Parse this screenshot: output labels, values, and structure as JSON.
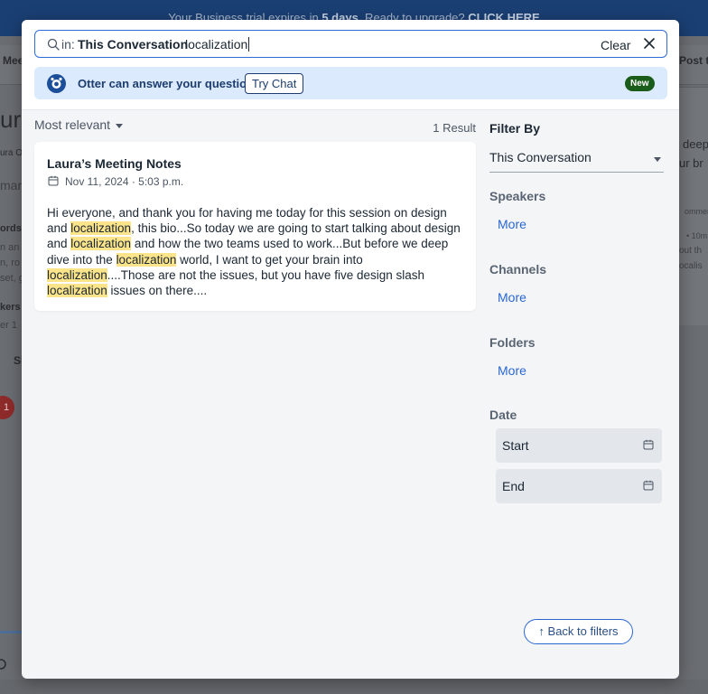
{
  "background": {
    "banner_text": "Your Business trial expires in",
    "banner_days": "5 days",
    "banner_cta_prefix": ". Ready to upgrade?",
    "banner_cta": "CLICK HERE",
    "nav_left": "Mee",
    "nav_right": "Post t",
    "right_tab": "line",
    "title_fragment": "ur",
    "author_fragment": "ura O",
    "summary_fragment": "mar",
    "keywords_label": "ords",
    "kw_lines": [
      "n an",
      "n, ro",
      "set, g"
    ],
    "speakers_label": "kers",
    "speaker_fragment": "er 1",
    "share_fragment": "Sh",
    "badge": "1",
    "rp_line1": "deep",
    "rp_line2": "ur br",
    "rp_comment": "ommen",
    "rp_time": "•  10m",
    "rp_out1": "out th",
    "rp_out2": "ocalis"
  },
  "search": {
    "scope_prefix": "in:",
    "scope": "This Conversation",
    "query": "localization",
    "clear_label": "Clear"
  },
  "otter_prompt": {
    "message": "Otter can answer your question",
    "button": "Try Chat",
    "badge": "New"
  },
  "results": {
    "sort_label": "Most relevant",
    "count_label": "1 Result",
    "items": [
      {
        "title": "Laura’s Meeting Notes",
        "date": "Nov 11, 2024 · 5:03 p.m.",
        "snippet_parts": [
          "Hi everyone, and thank you for having me today for this session on design and ",
          "localization",
          ", this bio...So today we are going to start talking about design and ",
          "localization",
          " and how the two teams used to work...But before we deep dive into the ",
          "localization",
          " world, I want to get your brain into ",
          "localization",
          "....Those are not the issues, but you have five design slash ",
          "localization",
          " issues on there...."
        ]
      }
    ]
  },
  "filters": {
    "heading": "Filter By",
    "scope_select": "This Conversation",
    "speakers_label": "Speakers",
    "speakers_more": "More",
    "channels_label": "Channels",
    "channels_more": "More",
    "folders_label": "Folders",
    "folders_more": "More",
    "date_label": "Date",
    "start_label": "Start",
    "end_label": "End"
  },
  "back_button": "↑ Back to filters",
  "colors": {
    "accent": "#2a67d1",
    "highlight": "#fbe48a",
    "new_badge": "#1a5c1a",
    "banner": "#1a3f73"
  }
}
